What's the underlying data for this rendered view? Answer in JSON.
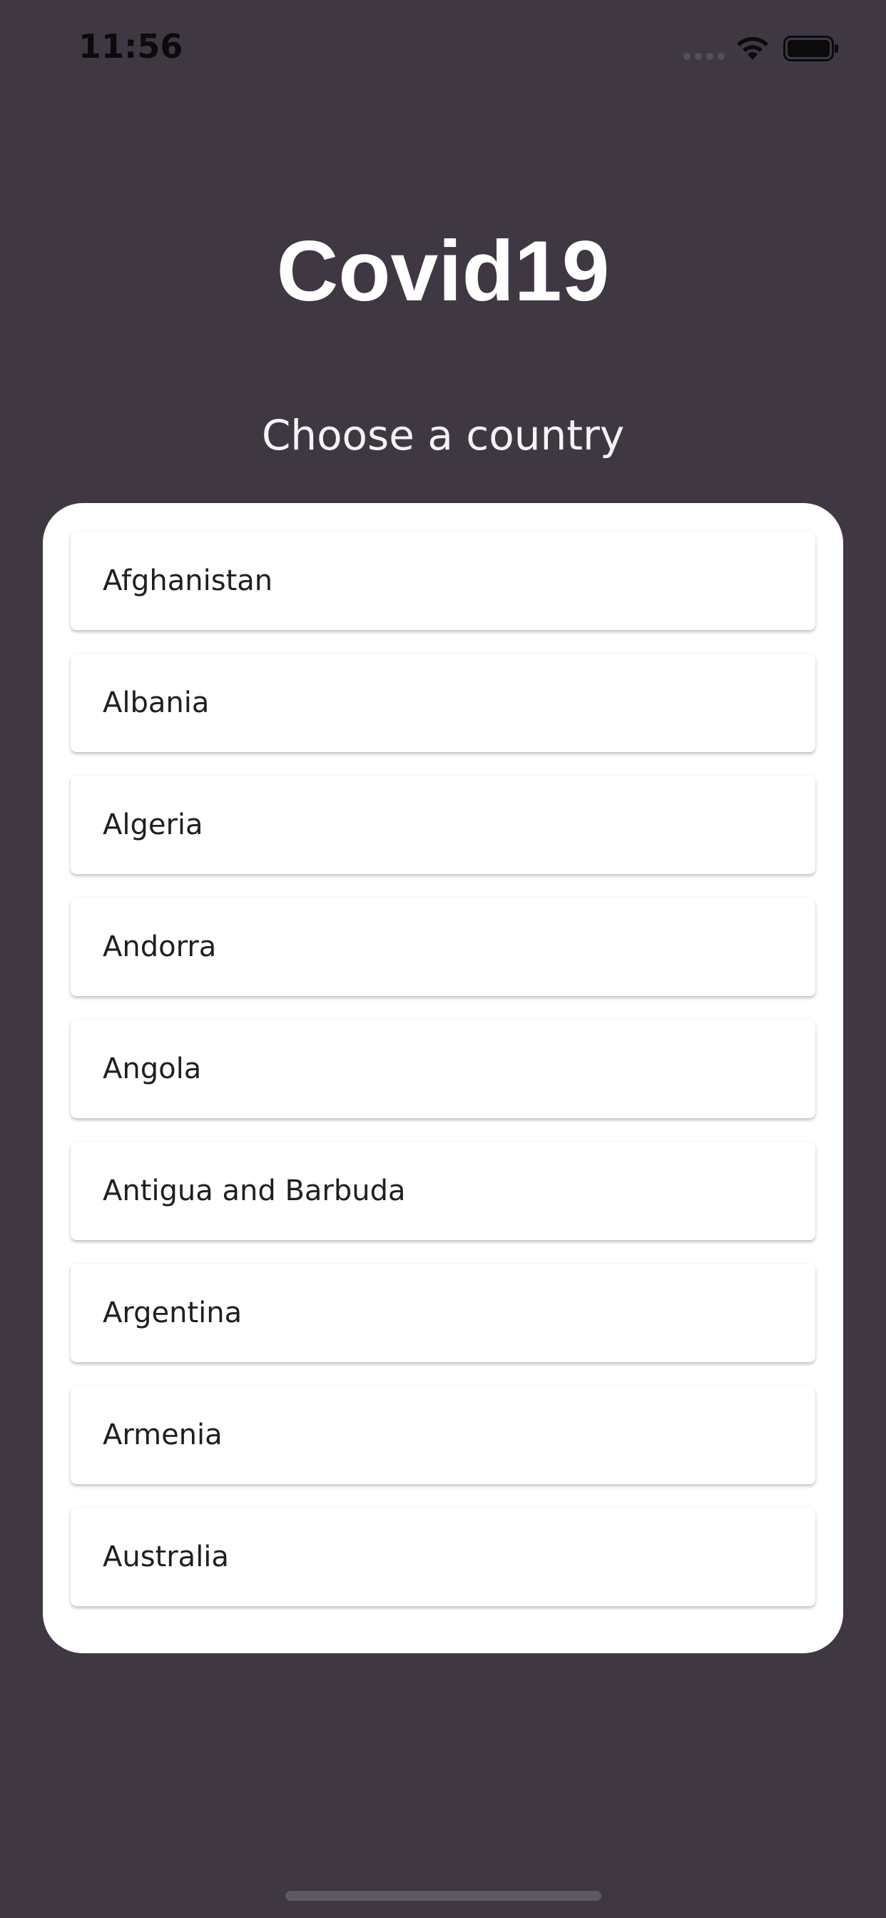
{
  "status_bar": {
    "time": "11:56"
  },
  "header": {
    "title": "Covid19",
    "subtitle": "Choose a country"
  },
  "countries": [
    "Afghanistan",
    "Albania",
    "Algeria",
    "Andorra",
    "Angola",
    "Antigua and Barbuda",
    "Argentina",
    "Armenia",
    "Australia"
  ],
  "colors": {
    "background": "#3f3843",
    "card": "#ffffff",
    "text_light": "#ffffff",
    "text_dark": "#1f1f22"
  },
  "icons": {
    "signal": "signal-dots-icon",
    "wifi": "wifi-icon",
    "battery": "battery-icon"
  }
}
